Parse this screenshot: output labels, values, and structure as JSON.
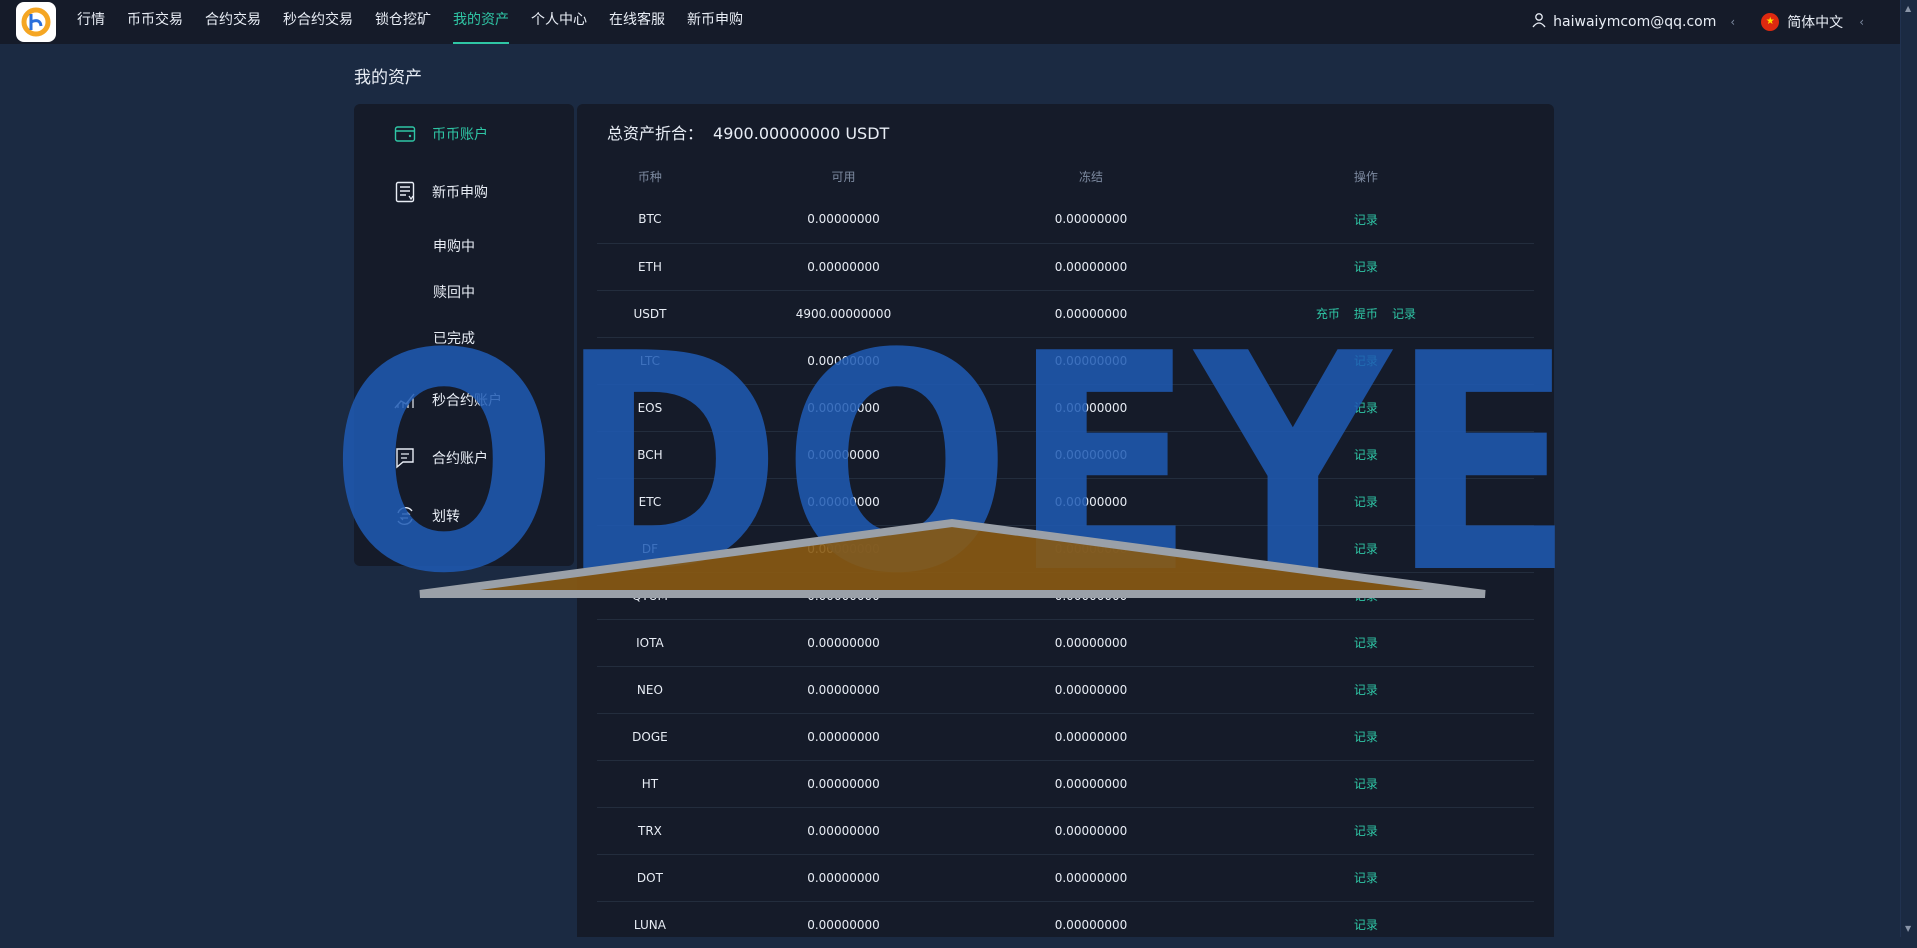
{
  "nav": {
    "items": [
      {
        "label": "行情",
        "active": false
      },
      {
        "label": "币币交易",
        "active": false
      },
      {
        "label": "合约交易",
        "active": false
      },
      {
        "label": "秒合约交易",
        "active": false
      },
      {
        "label": "锁仓挖矿",
        "active": false
      },
      {
        "label": "我的资产",
        "active": true
      },
      {
        "label": "个人中心",
        "active": false
      },
      {
        "label": "在线客服",
        "active": false
      },
      {
        "label": "新币申购",
        "active": false
      }
    ],
    "user_email": "haiwaiymcom@qq.com",
    "language": "简体中文"
  },
  "page_title": "我的资产",
  "sidebar": {
    "spot_account": "币币账户",
    "new_coin": "新币申购",
    "sub_items": [
      "申购中",
      "赎回中",
      "已完成"
    ],
    "seconds_contract": "秒合约账户",
    "contract_account": "合约账户",
    "transfer": "划转"
  },
  "assets": {
    "total_label": "总资产折合：",
    "total_value": "4900.00000000 USDT",
    "columns": [
      "币种",
      "可用",
      "冻结",
      "操作"
    ],
    "deposit_label": "充币",
    "withdraw_label": "提币",
    "record_label": "记录",
    "rows": [
      {
        "coin": "BTC",
        "available": "0.00000000",
        "frozen": "0.00000000"
      },
      {
        "coin": "ETH",
        "available": "0.00000000",
        "frozen": "0.00000000"
      },
      {
        "coin": "USDT",
        "available": "4900.00000000",
        "frozen": "0.00000000"
      },
      {
        "coin": "LTC",
        "available": "0.00000000",
        "frozen": "0.00000000"
      },
      {
        "coin": "EOS",
        "available": "0.00000000",
        "frozen": "0.00000000"
      },
      {
        "coin": "BCH",
        "available": "0.00000000",
        "frozen": "0.00000000"
      },
      {
        "coin": "ETC",
        "available": "0.00000000",
        "frozen": "0.00000000"
      },
      {
        "coin": "DF",
        "available": "0.00000000",
        "frozen": "0.00000000"
      },
      {
        "coin": "QTUM",
        "available": "0.00000000",
        "frozen": "0.00000000"
      },
      {
        "coin": "IOTA",
        "available": "0.00000000",
        "frozen": "0.00000000"
      },
      {
        "coin": "NEO",
        "available": "0.00000000",
        "frozen": "0.00000000"
      },
      {
        "coin": "DOGE",
        "available": "0.00000000",
        "frozen": "0.00000000"
      },
      {
        "coin": "HT",
        "available": "0.00000000",
        "frozen": "0.00000000"
      },
      {
        "coin": "TRX",
        "available": "0.00000000",
        "frozen": "0.00000000"
      },
      {
        "coin": "DOT",
        "available": "0.00000000",
        "frozen": "0.00000000"
      },
      {
        "coin": "LUNA",
        "available": "0.00000000",
        "frozen": "0.00000000"
      }
    ]
  },
  "watermark": "ODOEYE",
  "colors": {
    "accent": "#2fc6a5",
    "panel": "#151b29",
    "background": "#1b2a42"
  }
}
